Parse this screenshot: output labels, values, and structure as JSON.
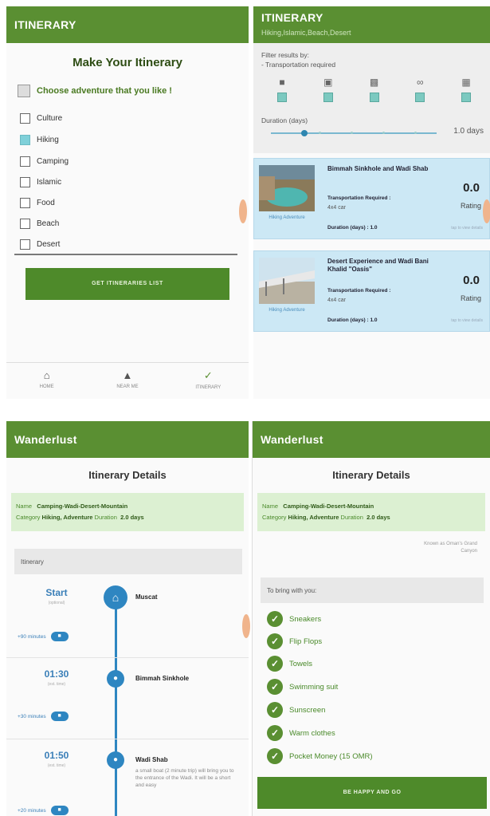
{
  "panel1": {
    "appbar_title": "ITINERARY",
    "title": "Make Your Itinerary",
    "choose_label": "Choose adventure that you like !",
    "options": [
      {
        "label": "Culture",
        "checked": false
      },
      {
        "label": "Hiking",
        "checked": true
      },
      {
        "label": "Camping",
        "checked": false
      },
      {
        "label": "Islamic",
        "checked": false
      },
      {
        "label": "Food",
        "checked": false
      },
      {
        "label": "Beach",
        "checked": false
      },
      {
        "label": "Desert",
        "checked": false
      }
    ],
    "button_label": "GET ITINERARIES LIST",
    "nav": [
      {
        "label": "HOME",
        "icon": "home-icon"
      },
      {
        "label": "NEAR ME",
        "icon": "person-icon"
      },
      {
        "label": "ITINERARY",
        "icon": "itinerary-icon"
      }
    ]
  },
  "panel2": {
    "appbar_title": "ITINERARY",
    "appbar_subtitle": "Hiking,Islamic,Beach,Desert",
    "filter_label": "Filter results by:",
    "transport_label": "- Transportation required",
    "duration_label": "Duration (days)",
    "duration_value": "1.0 days",
    "duration_fraction": 0.2,
    "vehicles": [
      "car",
      "suv",
      "taxi",
      "motorbike",
      "bus"
    ],
    "cards": [
      {
        "title": "Bimmah Sinkhole and Wadi Shab",
        "category": "Hiking Adventure",
        "transport_label": "Transportation Required :",
        "transport_value": "4x4 car",
        "duration": "Duration (days) : 1.0",
        "link": "tap to view details",
        "rating": "0.0",
        "rating_label": "Rating"
      },
      {
        "title": "Desert Experience and Wadi Bani Khalid \"Oasis\"",
        "category": "Hiking Adventure",
        "transport_label": "Transportation Required :",
        "transport_value": "4x4 car",
        "duration": "Duration (days) : 1.0",
        "link": "tap to view details",
        "rating": "0.0",
        "rating_label": "Rating"
      }
    ]
  },
  "panel3": {
    "appbar_title": "Wanderlust",
    "title": "Itinerary Details",
    "name_label": "Name",
    "name_value": "Camping-Wadi-Desert-Mountain",
    "category_label": "Category",
    "category_value": "Hiking, Adventure",
    "duration_label": "Duration",
    "duration_value": "2.0 days",
    "section": "Itinerary",
    "stops": [
      {
        "time": "Start",
        "sub": "(optional)",
        "place": "Muscat",
        "desc": ""
      },
      {
        "time": "01:30",
        "sub": "(est. time)",
        "place": "Bimmah Sinkhole",
        "desc": ""
      },
      {
        "time": "01:50",
        "sub": "(est. time)",
        "place": "Wadi Shab",
        "desc": "a small boat (2 minute trip) will bring you to the entrance of the Wadi. It will be a short and easy"
      }
    ],
    "transfers": [
      "+90 minutes",
      "+30 minutes",
      "+20 minutes"
    ]
  },
  "panel4": {
    "appbar_title": "Wanderlust",
    "title": "Itinerary Details",
    "name_label": "Name",
    "name_value": "Camping-Wadi-Desert-Mountain",
    "category_label": "Category",
    "category_value": "Hiking, Adventure",
    "duration_label": "Duration",
    "duration_value": "2.0 days",
    "note": "Known as Oman's Grand Canyon",
    "section": "To bring with you:",
    "items": [
      "Sneakers",
      "Flip Flops",
      "Towels",
      "Swimming suit",
      "Sunscreen",
      "Warm clothes",
      "Pocket Money (15 OMR)"
    ],
    "button_label": "BE HAPPY AND GO"
  }
}
